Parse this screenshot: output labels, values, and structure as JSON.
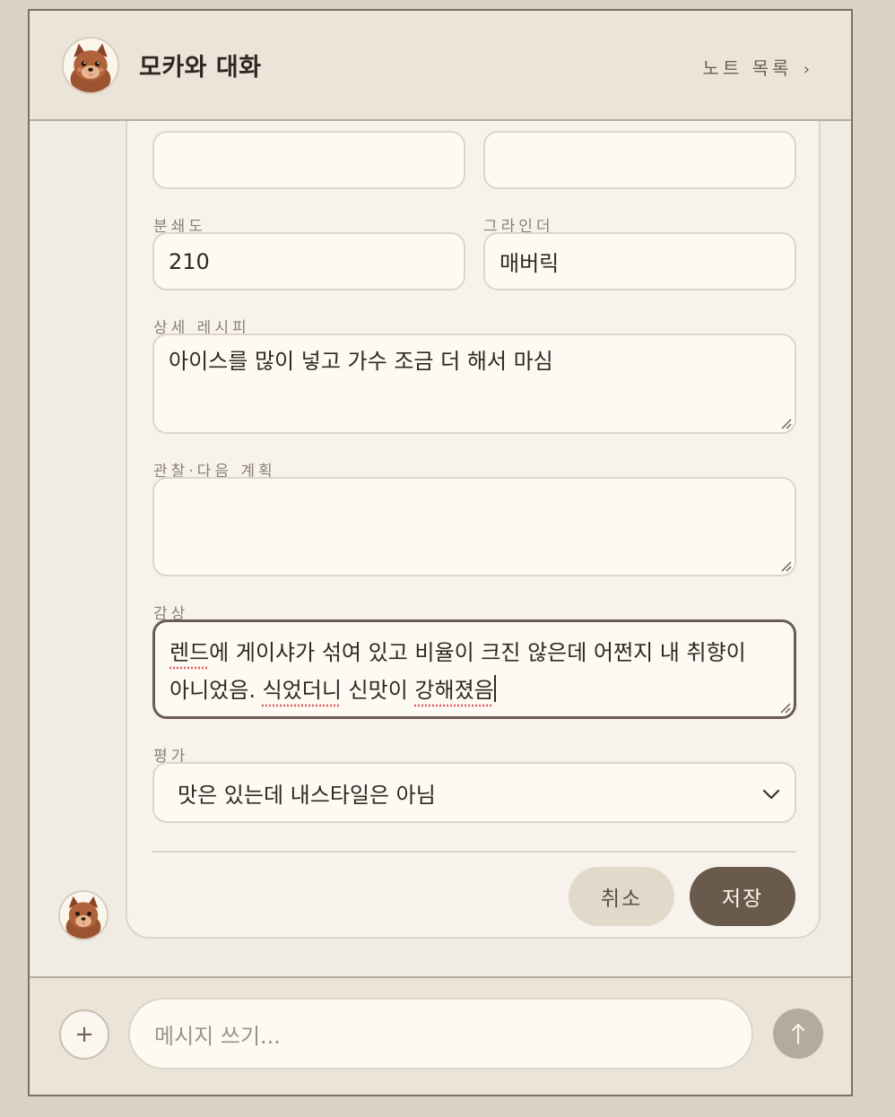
{
  "header": {
    "title": "모카와 대화",
    "notes_link": "노트 목록",
    "notes_chevron": "›"
  },
  "form": {
    "fields": {
      "grind_label": "분쇄도",
      "grind_value": "210",
      "grinder_label": "그라인더",
      "grinder_value": "매버릭",
      "recipe_label": "상세 레시피",
      "recipe_value": "아이스를 많이 넣고 가수 조금 더 해서 마심",
      "observation_label": "관찰·다음 계획",
      "observation_value": "",
      "tasting_label": "감상",
      "tasting_line1_a": "렌드",
      "tasting_line1_b": "에 게이샤가 섞여 있고 비율이 크진 않은데 어쩐지 내 취향이",
      "tasting_line2_a": "아니었음. ",
      "tasting_line2_b": "식었더니",
      "tasting_line2_c": " 신맛이 ",
      "tasting_line2_d": "강해졌음",
      "rating_label": "평가",
      "rating_value": "맛은 있는데 내스타일은 아님"
    },
    "cancel_label": "취소",
    "save_label": "저장"
  },
  "composer": {
    "plus_label": "+",
    "placeholder": "메시지 쓰기...",
    "send_icon": "arrow-up-icon"
  },
  "icons": {
    "avatar": "pomeranian-dog-avatar",
    "dropdown": "chevron-down-icon",
    "resize": "resize-grip-icon"
  },
  "colors": {
    "accent": "#6a5a4b",
    "background": "#dcd3c7",
    "card": "#f7f3ec",
    "spellcheck": "#e05a5a"
  }
}
